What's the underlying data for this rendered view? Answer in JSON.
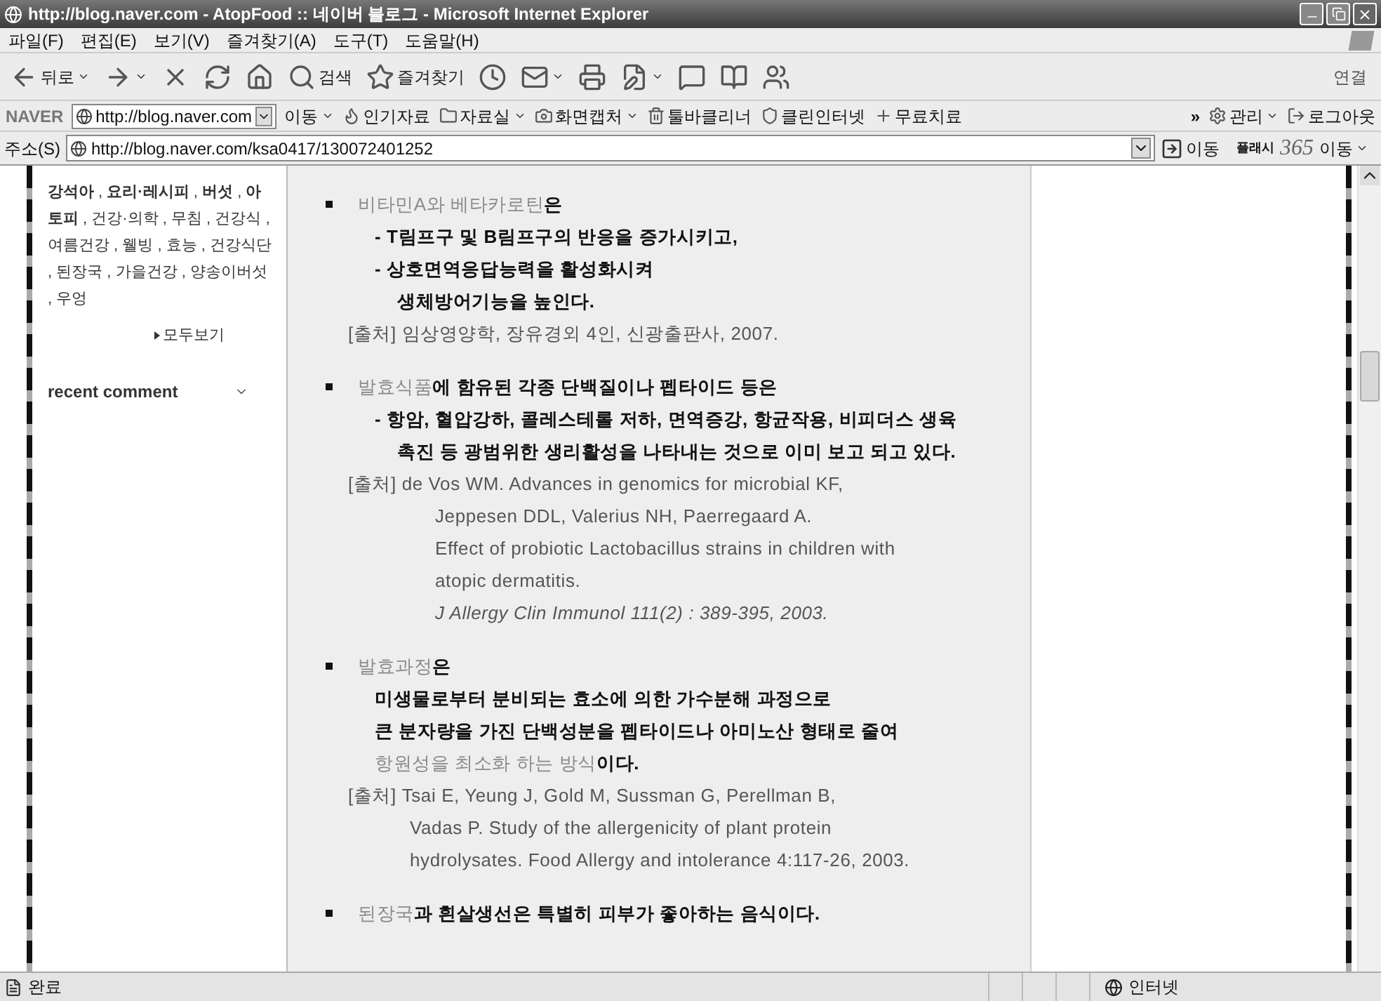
{
  "window": {
    "title": "http://blog.naver.com - AtopFood :: 네이버 블로그 - Microsoft Internet Explorer"
  },
  "menu": [
    "파일(F)",
    "편집(E)",
    "보기(V)",
    "즐겨찾기(A)",
    "도구(T)",
    "도움말(H)"
  ],
  "toolbar": {
    "buttons": [
      {
        "kind": "back",
        "label": "뒤로",
        "dropdown": true
      },
      {
        "kind": "forward",
        "dropdown": true
      },
      {
        "kind": "stop",
        "dropdown": false
      },
      {
        "kind": "refresh",
        "dropdown": false
      },
      {
        "kind": "home",
        "dropdown": false
      },
      {
        "kind": "search",
        "label": "검색",
        "dropdown": false
      },
      {
        "kind": "favorites",
        "label": "즐겨찾기",
        "dropdown": false
      },
      {
        "kind": "history",
        "dropdown": false
      },
      {
        "kind": "mail",
        "dropdown": true
      },
      {
        "kind": "print",
        "dropdown": false
      },
      {
        "kind": "edit",
        "dropdown": true
      },
      {
        "kind": "discuss",
        "dropdown": false
      },
      {
        "kind": "research",
        "dropdown": false
      },
      {
        "kind": "messenger",
        "dropdown": false
      }
    ],
    "links_label": "연결"
  },
  "naver_toolbar": {
    "logo": "NAVER",
    "url": "http://blog.naver.com",
    "go": "이동",
    "items": [
      {
        "kind": "popular",
        "label": "인기자료",
        "dropdown": false
      },
      {
        "kind": "library",
        "label": "자료실",
        "dropdown": true
      },
      {
        "kind": "capture",
        "label": "화면캡처",
        "dropdown": true
      },
      {
        "kind": "cleaner",
        "label": "툴바클리너",
        "dropdown": false
      },
      {
        "kind": "clean",
        "label": "클린인터넷",
        "dropdown": false
      },
      {
        "kind": "free",
        "label": "무료치료",
        "dropdown": false
      }
    ],
    "more": "»",
    "right": [
      {
        "kind": "settings",
        "label": "관리",
        "dropdown": true
      },
      {
        "kind": "logout",
        "label": "로그아웃",
        "dropdown": false
      }
    ]
  },
  "address_bar": {
    "label": "주소(S)",
    "url": "http://blog.naver.com/ksa0417/130072401252",
    "go": "이동",
    "flash_label": "플래시",
    "flash_number": "365",
    "flash_go": "이동"
  },
  "sidebar": {
    "tags": "**강석아** , **요리·레시피** , **버섯** , **아토피** , 건강·의학 , 무침 , 건강식 , 여름건강 , 웰빙 , 효능 , 건강식단 , 된장국 , 가을건강 , 양송이버섯 , 우엉",
    "more": "모두보기",
    "recent_comment": "recent comment"
  },
  "post": {
    "blocks": [
      {
        "lines": [
          {
            "kind": "bullet",
            "segments": [
              {
                "text": "비타민A와 베타카로틴",
                "bold": false,
                "muted": true,
                "italic": false
              },
              {
                "text": "은",
                "bold": true,
                "muted": false,
                "italic": false
              }
            ]
          },
          {
            "kind": "sub",
            "segments": [
              {
                "text": "- T림프구 및 B림프구의 반응을 증가시키고,",
                "bold": true,
                "muted": false,
                "italic": false
              }
            ]
          },
          {
            "kind": "sub",
            "segments": [
              {
                "text": "- 상호면역응답능력을 활성화시켜",
                "bold": true,
                "muted": false,
                "italic": false
              }
            ]
          },
          {
            "kind": "sub-cont",
            "segments": [
              {
                "text": "생체방어기능을 높인다.",
                "bold": true,
                "muted": false,
                "italic": false
              }
            ]
          },
          {
            "kind": "cite",
            "segments": [
              {
                "text": "[출처] 임상영양학, 장유경외 4인, 신광출판사, 2007.",
                "bold": false,
                "muted": false,
                "italic": false
              }
            ]
          }
        ]
      },
      {
        "lines": [
          {
            "kind": "bullet",
            "segments": [
              {
                "text": "발효식품",
                "bold": false,
                "muted": true,
                "italic": false
              },
              {
                "text": "에 함유된 각종 단백질이나 펩타이드 등은",
                "bold": true,
                "muted": false,
                "italic": false
              }
            ]
          },
          {
            "kind": "sub",
            "segments": [
              {
                "text": "- 항암, 혈압강하, 콜레스테롤 저하, 면역증강, 항균작용, 비피더스 생육",
                "bold": true,
                "muted": false,
                "italic": false
              }
            ]
          },
          {
            "kind": "sub-cont",
            "segments": [
              {
                "text": "촉진 등  광범위한 생리활성을 나타내는 것으로 이미 보고 되고 있다.",
                "bold": true,
                "muted": false,
                "italic": false
              }
            ]
          },
          {
            "kind": "cite",
            "segments": [
              {
                "text": "[출처] de Vos WM. Advances in genomics for microbial KF,",
                "bold": false,
                "muted": false,
                "italic": false
              }
            ]
          },
          {
            "kind": "cite-cont",
            "segments": [
              {
                "text": "Jeppesen DDL, Valerius NH, Paerregaard A.",
                "bold": false,
                "muted": false,
                "italic": false
              }
            ]
          },
          {
            "kind": "cite-cont",
            "segments": [
              {
                "text": "Effect of probiotic Lactobacillus strains in children with",
                "bold": false,
                "muted": false,
                "italic": false
              }
            ]
          },
          {
            "kind": "cite-cont",
            "segments": [
              {
                "text": "atopic dermatitis.",
                "bold": false,
                "muted": false,
                "italic": false
              }
            ]
          },
          {
            "kind": "cite-cont",
            "segments": [
              {
                "text": "J Allergy Clin Immunol 111(2) : 389-395, 2003.",
                "bold": false,
                "muted": false,
                "italic": true
              }
            ]
          }
        ]
      },
      {
        "lines": [
          {
            "kind": "bullet",
            "segments": [
              {
                "text": "발효과정",
                "bold": false,
                "muted": true,
                "italic": false
              },
              {
                "text": "은",
                "bold": true,
                "muted": false,
                "italic": false
              }
            ]
          },
          {
            "kind": "body",
            "segments": [
              {
                "text": "미생물로부터 분비되는 효소에 의한 가수분해 과정으로",
                "bold": true,
                "muted": false,
                "italic": false
              }
            ]
          },
          {
            "kind": "body",
            "segments": [
              {
                "text": "큰 분자량을 가진 단백성분을 펩타이드나 아미노산 형태로 줄여",
                "bold": true,
                "muted": false,
                "italic": false
              }
            ]
          },
          {
            "kind": "body",
            "segments": [
              {
                "text": "항원성을 최소화 하는 방식",
                "bold": false,
                "muted": true,
                "italic": false
              },
              {
                "text": "이다.",
                "bold": true,
                "muted": false,
                "italic": false
              }
            ]
          },
          {
            "kind": "cite",
            "segments": [
              {
                "text": "[출처] Tsai E, Yeung J, Gold M, Sussman G, Perellman B,",
                "bold": false,
                "muted": false,
                "italic": false
              }
            ]
          },
          {
            "kind": "cite-wrap",
            "segments": [
              {
                "text": "Vadas P. Study of the allergenicity of plant protein",
                "bold": false,
                "muted": false,
                "italic": false
              }
            ]
          },
          {
            "kind": "cite-wrap",
            "segments": [
              {
                "text": "hydrolysates. Food Allergy and intolerance 4:117-26, 2003.",
                "bold": false,
                "muted": false,
                "italic": false
              }
            ]
          }
        ]
      },
      {
        "lines": [
          {
            "kind": "bullet",
            "segments": [
              {
                "text": "된장국",
                "bold": false,
                "muted": true,
                "italic": false
              },
              {
                "text": "과 흰살생선은 특별히 피부가 좋아하는 음식이다.",
                "bold": true,
                "muted": false,
                "italic": false
              }
            ]
          }
        ]
      }
    ]
  },
  "status_bar": {
    "status": "완료",
    "zone": "인터넷"
  }
}
